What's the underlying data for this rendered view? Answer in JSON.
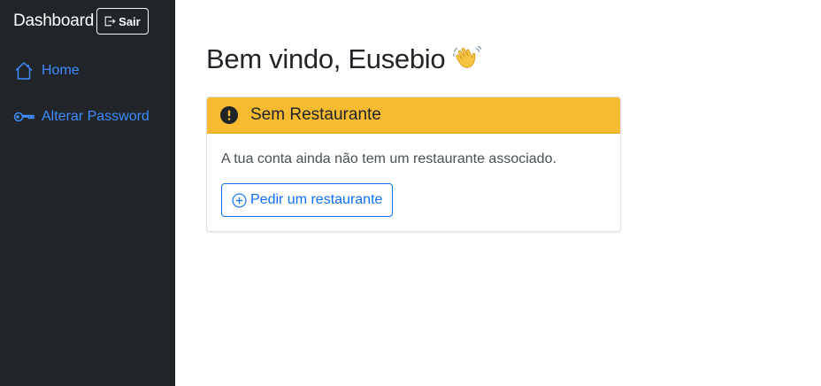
{
  "sidebar": {
    "brand": "Dashboard",
    "logout": {
      "label": "Sair",
      "icon": "box-arrow-right-icon"
    },
    "items": [
      {
        "label": "Home",
        "icon": "house-icon"
      },
      {
        "label": "Alterar Password",
        "icon": "key-icon"
      }
    ]
  },
  "main": {
    "greeting": "Bem vindo, Eusebio",
    "greeting_emoji": "waving-hand-icon",
    "card": {
      "title": "Sem Restaurante",
      "title_icon": "exclamation-circle-icon",
      "message": "A tua conta ainda não tem um restaurante associado.",
      "action_label": "Pedir um restaurante",
      "action_icon": "plus-circle-icon"
    }
  },
  "colors": {
    "sidebar_bg": "#212529",
    "link": "#3d8bfd",
    "warning": "#f6bb31",
    "primary": "#0d6efd"
  }
}
